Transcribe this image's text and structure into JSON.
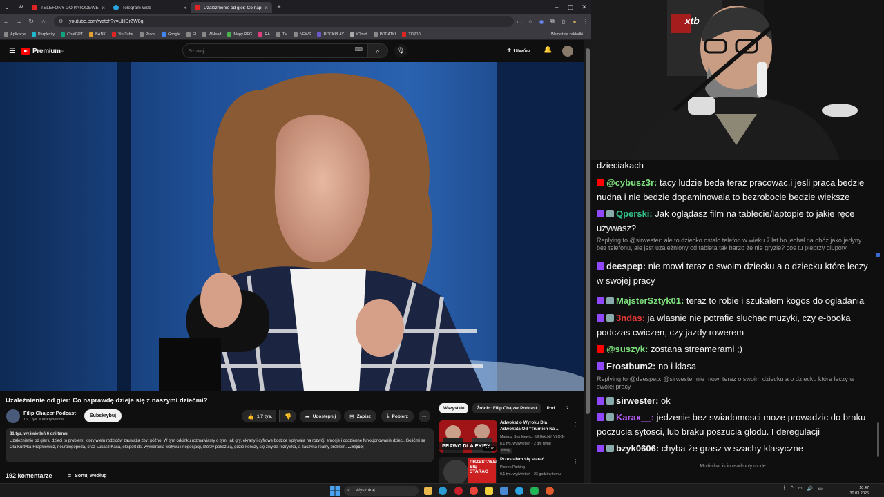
{
  "browser": {
    "tabs": [
      {
        "label": "TELEFONY DO PATODEWELOPER",
        "color": "#e02424"
      },
      {
        "label": "Telegram Web",
        "color": "#2aa3e0"
      },
      {
        "label": "Uzależnienie od gier: Co naprawd",
        "color": "#e02424"
      }
    ],
    "url": "youtube.com/watch?v=UlilDrZW8qI",
    "bookmarks": [
      "Aplikacje",
      "Perplexity",
      "ChatGPT",
      "BANK",
      "YouTube",
      "Praca",
      "Google",
      "EI",
      "WHead",
      "Mapy RPG",
      "RA",
      "TV",
      "NEWS",
      "ROCKPLAY",
      "iCloud",
      "PODATKI",
      "TOP10"
    ],
    "all_bookmarks": "Wszystkie zakładki"
  },
  "youtube": {
    "logo": "Premium",
    "logo_sup": "PL",
    "search_placeholder": "Szukaj",
    "create": "Utwórz",
    "video_title": "Uzależnienie od gier: Co naprawdę dzieje się z naszymi dziećmi?",
    "channel_name": "Filip Chajzer Podcast",
    "channel_subs": "16,1 tys. subskrybentów",
    "subscribe": "Subskrybuj",
    "likes": "1,7 tys.",
    "share": "Udostępnij",
    "save": "Zapisz",
    "download": "Pobierz",
    "desc_meta": "81 tys. wyświetleń  6 dni temu",
    "desc_text": "Uzależnienie od gier u dzieci to problem, który wielu rodziców zauważa zbyt późno. W tym odcinku rozmawiamy o tym, jak gry, ekrany i cyfrowe bodźce wpływają na rozwój, emocje i codzienne funkcjonowanie dzieci. Gośćmi są Ola Kurtyka-Hrapkiewicz, neurologopeda, oraz Łukasz Kaca, ekspert ds. wywierania wpływu i negocjacji, którzy pokazują, gdzie kończy się zwykła rozrywka, a zaczyna realny problem.",
    "desc_more": "...więcej",
    "comments": "192 komentarze",
    "sort": "Sortuj według",
    "chips": [
      "Wszystkie",
      "Źródło: Filip Chajzer Podcast",
      "Pod"
    ],
    "recs": [
      {
        "title": "Adwokat o Wyroku Dla Adwokata Od \"Trumien Na ...",
        "author": "Mariusz Stankiewicz (LEGALNY VLOG)",
        "meta": "8,1 tys. wyświetleń • 2 dni temu",
        "badge": "Nowy",
        "duration": "27:18",
        "thumb_text": "PRAWO DLA EKIPY"
      },
      {
        "title": "Przestałem się starać.",
        "author": "Piotrek Parking",
        "meta": "9,1 tys. wyświetleń • 23 godziny temu",
        "badge": "",
        "duration": "",
        "thumb_text": "PRZESTAŁEM SIĘ STARAĆ"
      }
    ]
  },
  "chat": {
    "top_text": "dzieciakach",
    "messages": [
      {
        "platform": "yt",
        "user": "@cybusz3r:",
        "user_color": "#7ee07e",
        "text": "tacy ludzie beda teraz pracowac,i jesli praca bedzie nudna i nie bedzie dopaminowala to bezrobocie bedzie wieksze"
      },
      {
        "platform": "tw",
        "user": "Qperski:",
        "user_color": "#31c48d",
        "text": "Jak oglądasz film na tablecie/laptopie to jakie ręce używasz?"
      },
      {
        "platform": "tw",
        "user": "deespep:",
        "user_color": "#f4f4f4",
        "text": "nie mowi teraz o swoim dziecku a o dziecku które leczy w swojej pracy"
      },
      {
        "platform": "tw",
        "user": "MajsterSztyk01:",
        "user_color": "#7ee07e",
        "text": "teraz to robie i szukalem kogos do ogladania"
      },
      {
        "platform": "tw",
        "user": "3ndas:",
        "user_color": "#e53935",
        "text": "ja wlasnie nie potrafie sluchac muzyki, czy e-booka podczas cwiczen, czy jazdy rowerem"
      },
      {
        "platform": "yt",
        "user": "@suszyk:",
        "user_color": "#7ee07e",
        "text": "zostana streamerami ;)"
      },
      {
        "platform": "tw",
        "user": "Frostbum2:",
        "user_color": "#f4f4f4",
        "text": "no i klasa"
      },
      {
        "platform": "tw",
        "user": "sirwester:",
        "user_color": "#f4f4f4",
        "text": "ok"
      },
      {
        "platform": "tw",
        "user": "Karax__:",
        "user_color": "#b45cf0",
        "text": "jedzenie bez swiadomosci moze prowadzic do braku poczucia sytosci, lub braku poszucia glodu. I deregulacji"
      },
      {
        "platform": "tw",
        "user": "bzyk0606:",
        "user_color": "#f4f4f4",
        "text": "chyba że grasz w szachy klasyczne"
      }
    ],
    "reply1": "Replying to @sirwester: ale to dziecko ostalo telefon w wieku 7 lat bo jechał na obóz jako jedyny bez telefonu, ale jest uzależniony od tableta tak barzo że nie gryzie? cos tu pieprzy glupoty",
    "reply2": "Replying to @deespep: @sirwester nie mowi teraz o swoim dziecku a o dziecku które leczy w swojej pracy",
    "readonly": "Multi-chat is in read-only mode",
    "cam_logo": "xtb"
  },
  "taskbar": {
    "search": "Wyszukaj",
    "time": "10:47",
    "date": "30.03.2026"
  },
  "colors": {
    "yt_red": "#ff0000",
    "twitch": "#9146ff",
    "accent": "#3ea6ff"
  }
}
